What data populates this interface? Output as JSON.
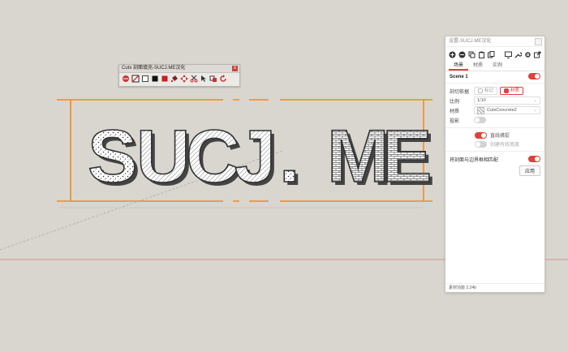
{
  "canvas": {
    "text": "SUCJ. ME",
    "colors": {
      "background": "#d9d6d0",
      "section_plane": "#f08a24",
      "axis_red": "#d3806a",
      "text_outline": "#3a3a3a"
    }
  },
  "toolbar": {
    "title": "Cutx 剖面填充-SUCJ.ME汉化",
    "icons": [
      "hatch-fill-icon",
      "section-toggle-icon",
      "white-square-icon",
      "black-square-icon",
      "red-square-icon",
      "paint-bucket-icon",
      "move-arrows-icon",
      "scissors-icon",
      "cursor-select-icon",
      "rotate-icon",
      "refresh-icon"
    ]
  },
  "panel": {
    "title": "设置-SUCJ.ME汉化",
    "icons": [
      "add-icon",
      "remove-icon",
      "copy-icon",
      "paste-icon",
      "duplicate-icon",
      "monitor-icon",
      "wrench-icon",
      "settings-icon",
      "external-link-icon"
    ],
    "tabs": [
      {
        "label": "场景",
        "active": true
      },
      {
        "label": "材质",
        "active": false
      },
      {
        "label": "实例",
        "active": false
      }
    ],
    "scene_name": "Scene 1",
    "scene_enabled": true,
    "cut_basis_label": "剖切依据",
    "cut_basis_options": [
      {
        "label": "标记",
        "selected": false
      },
      {
        "label": "材质",
        "selected": true
      }
    ],
    "scale_label": "比例",
    "scale_value": "1/10",
    "material_label": "材质",
    "material_value": "CutxConcrete2",
    "projection_label": "投影",
    "projection_enabled": false,
    "line_weight_label": "直线拂捉",
    "line_weight_enabled": true,
    "edge_width_label": "创建有线宽度",
    "edge_width_enabled": false,
    "clip_label": "将剖面与边界框相匹配",
    "clip_enabled": true,
    "apply_label": "应用",
    "footer": "素材功能 2.24b"
  }
}
